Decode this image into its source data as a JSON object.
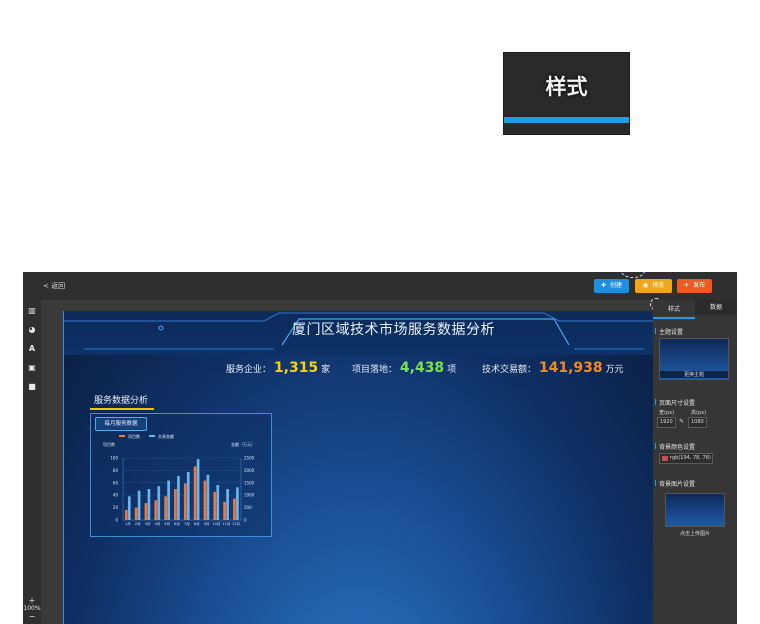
{
  "zoom_tab": {
    "label": "样式"
  },
  "topbar": {
    "back_label": "< 返回",
    "buttons": {
      "create": "创建",
      "preview": "预览",
      "publish": "发布"
    }
  },
  "left_tools": {
    "icons": [
      "chart-icon",
      "pie-icon",
      "text-icon",
      "image-icon",
      "video-icon"
    ],
    "zoom_plus": "+",
    "zoom_level": "100%",
    "zoom_minus": "−"
  },
  "canvas": {
    "title": "厦门区域技术市场服务数据分析",
    "stats": [
      {
        "label": "服务企业：",
        "value": "1,315",
        "unit": "家",
        "color": "#f5d400"
      },
      {
        "label": "项目落地：",
        "value": "4,438",
        "unit": "项",
        "color": "#7be34a"
      },
      {
        "label": "技术交易额：",
        "value": "141,938",
        "unit": "万元",
        "color": "#f58a1f"
      }
    ],
    "section_title": "服务数据分析",
    "panel_tab": "每月服务数据"
  },
  "chart_data": {
    "type": "bar",
    "categories": [
      "1月",
      "2月",
      "3月",
      "4月",
      "5月",
      "6月",
      "7月",
      "8月",
      "9月",
      "10月",
      "11月",
      "12月"
    ],
    "series": [
      {
        "name": "项目数",
        "color": "#f0773a",
        "values": [
          18,
          22,
          30,
          35,
          42,
          55,
          65,
          95,
          70,
          50,
          32,
          38
        ]
      },
      {
        "name": "交易金额",
        "color": "#6cb4ee",
        "values": [
          42,
          52,
          55,
          60,
          70,
          78,
          85,
          108,
          80,
          62,
          55,
          58
        ]
      }
    ],
    "ylabel_left": "项目数",
    "ylabel_right": "金额（万元）",
    "yticks_left": [
      "100",
      "80",
      "60",
      "40",
      "20",
      "0"
    ],
    "yticks_right": [
      "2500",
      "2000",
      "1500",
      "1000",
      "500",
      "0"
    ],
    "ylim": [
      0,
      110
    ]
  },
  "right_panel": {
    "tabs": [
      "样式",
      "数据"
    ],
    "sections": {
      "theme": "主题设置",
      "change_theme": "更换主题",
      "size": "页面尺寸设置",
      "width_label": "宽(px)",
      "height_label": "高(px)",
      "width": "1920",
      "height": "1080",
      "bgcolor": "背景颜色设置",
      "bgcolor_value": "rgb(194, 78, 78)",
      "bgcolor_swatch": "#c24e4e",
      "bgimage": "背景图片设置",
      "upload": "点击上传图片"
    }
  }
}
